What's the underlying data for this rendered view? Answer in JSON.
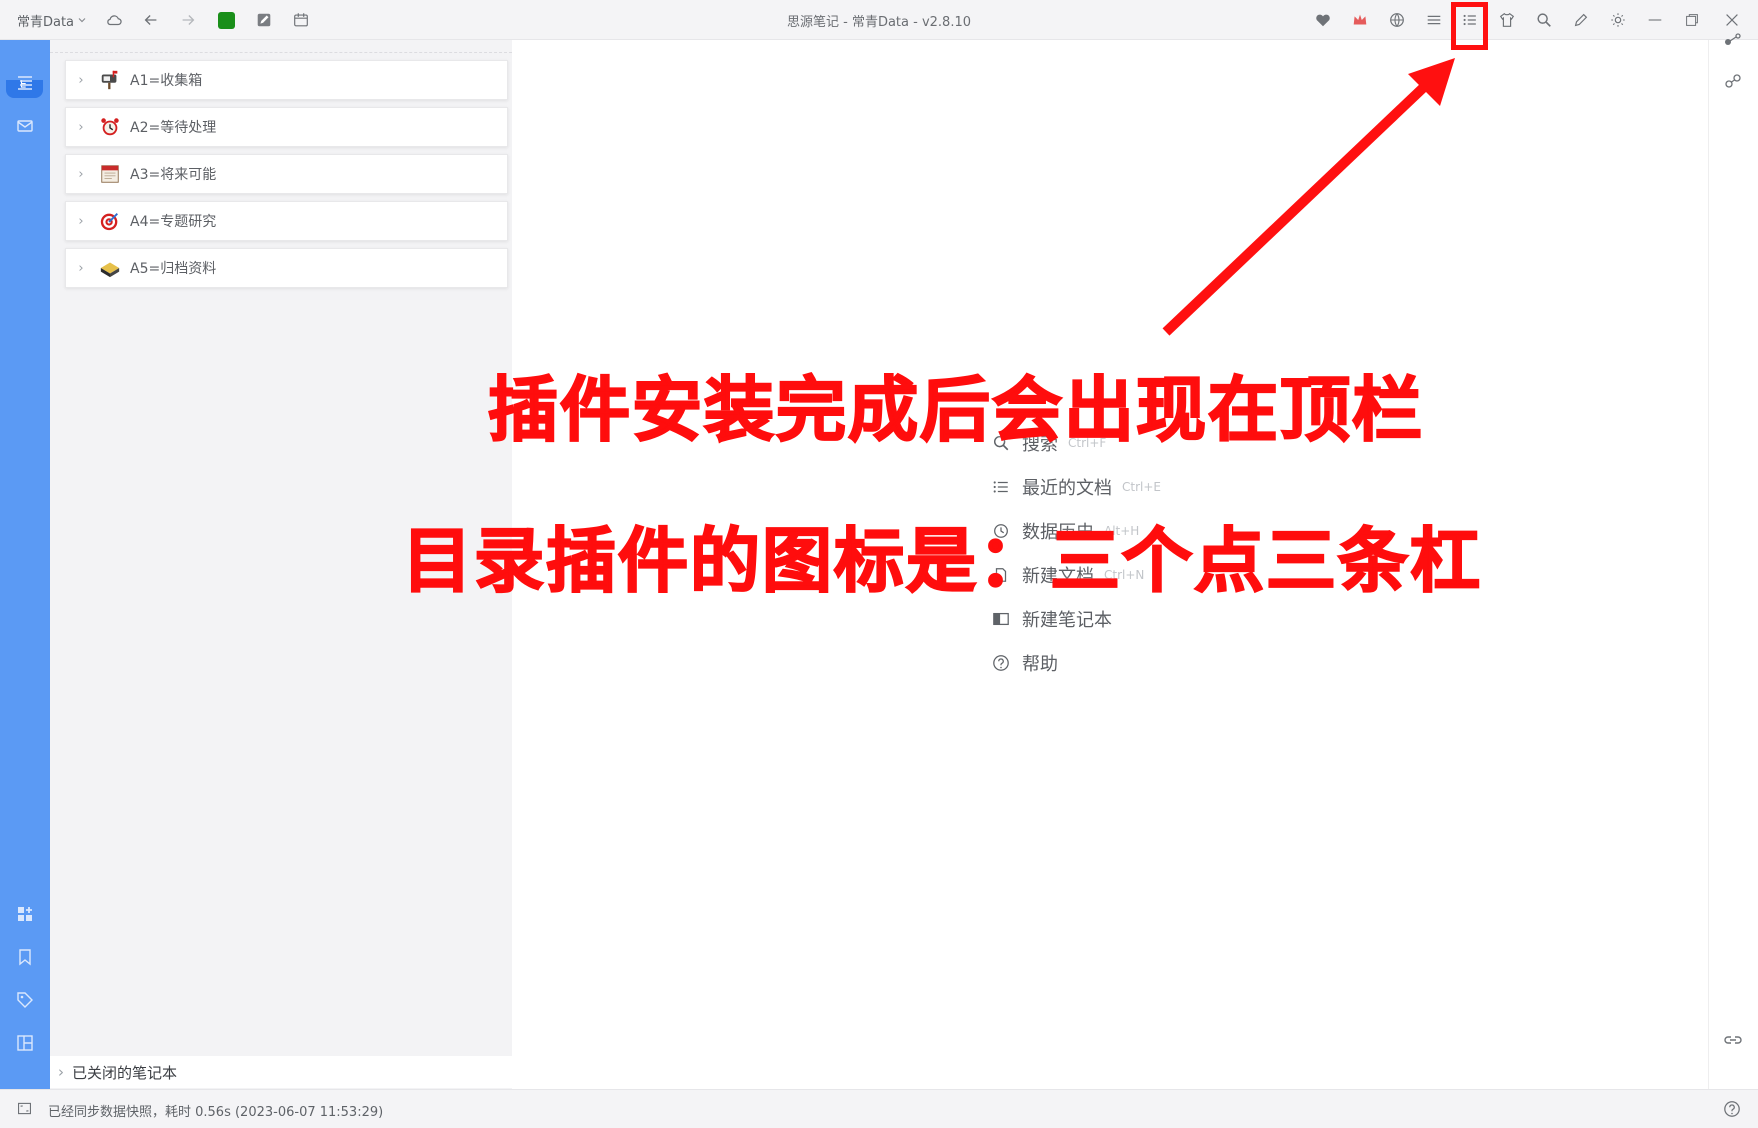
{
  "topbar": {
    "workspace_label": "常青Data",
    "window_title": "思源笔记 - 常青Data - v2.8.10"
  },
  "tree": {
    "items": [
      {
        "label": "A1=收集箱",
        "icon": "mailbox-icon"
      },
      {
        "label": "A2=等待处理",
        "icon": "alarm-clock-icon"
      },
      {
        "label": "A3=将来可能",
        "icon": "calendar-icon"
      },
      {
        "label": "A4=专题研究",
        "icon": "target-icon"
      },
      {
        "label": "A5=归档资料",
        "icon": "archive-box-icon"
      }
    ],
    "closed_notebooks_label": "已关闭的笔记本"
  },
  "empty_menu": {
    "items": [
      {
        "label": "搜索",
        "shortcut": "Ctrl+F",
        "icon": "search-icon"
      },
      {
        "label": "最近的文档",
        "shortcut": "Ctrl+E",
        "icon": "list-icon"
      },
      {
        "label": "数据历史",
        "shortcut": "Alt+H",
        "icon": "history-icon"
      },
      {
        "label": "新建文档",
        "shortcut": "Ctrl+N",
        "icon": "new-doc-icon"
      },
      {
        "label": "新建笔记本",
        "shortcut": "",
        "icon": "notebook-icon"
      },
      {
        "label": "帮助",
        "shortcut": "",
        "icon": "help-icon"
      }
    ]
  },
  "status": {
    "message": "已经同步数据快照，耗时 0.56s (2023-06-07 11:53:29)"
  },
  "annotation": {
    "line1": "插件安装完成后会出现在顶栏",
    "line2": "目录插件的图标是：三个点三条杠",
    "color": "#ff0d0d"
  },
  "colors": {
    "accent": "#5b9af4",
    "accent_dark": "#2f78e8",
    "green_badge": "#1a8f1a"
  }
}
